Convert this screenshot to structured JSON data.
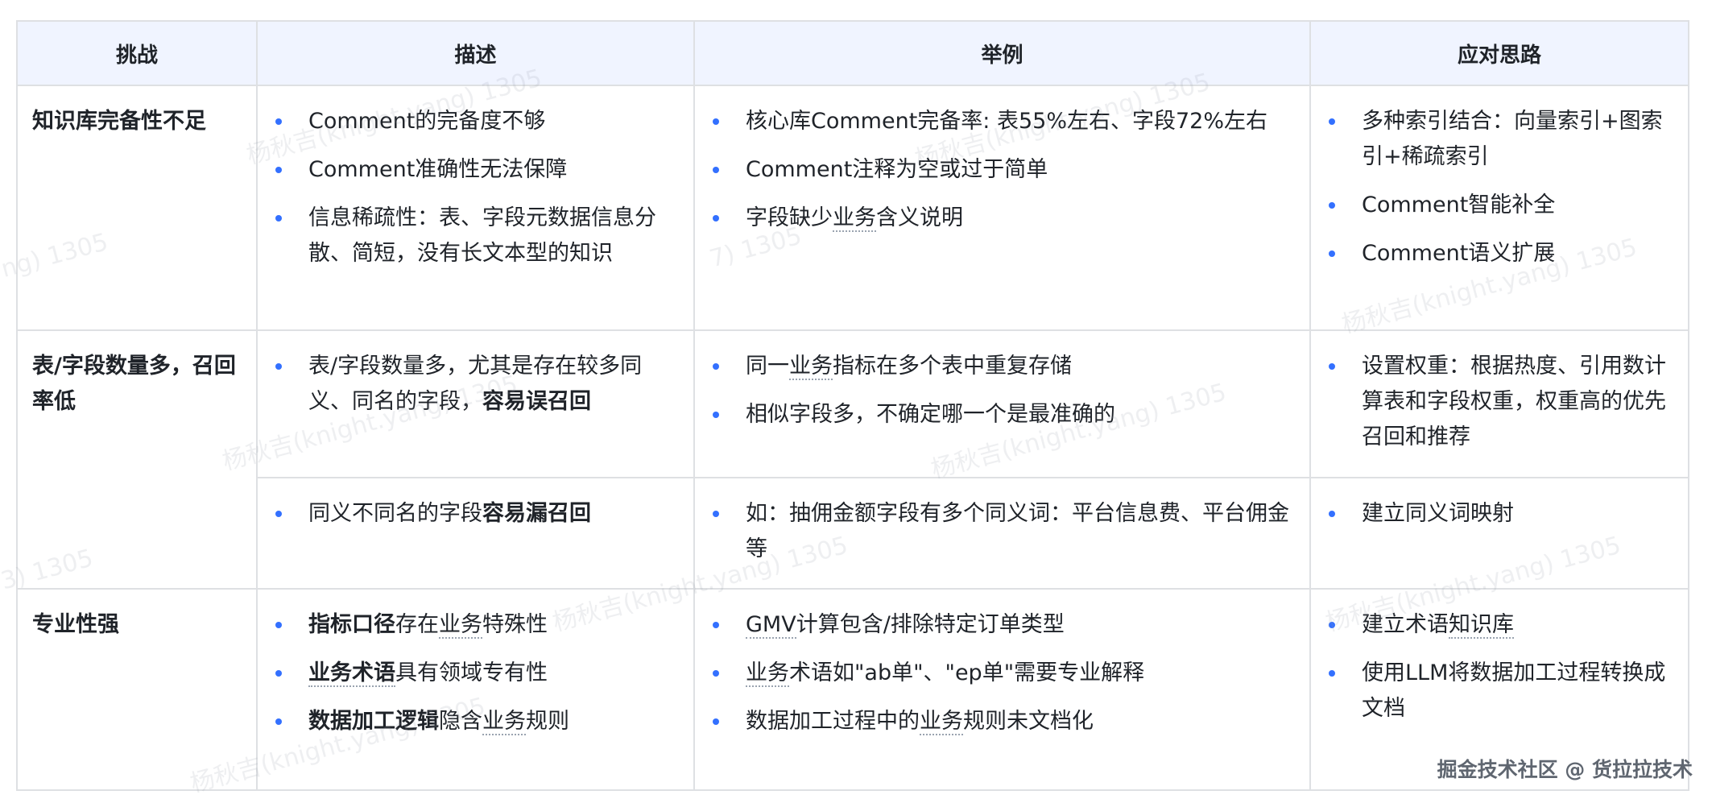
{
  "headers": [
    "挑战",
    "描述",
    "举例",
    "应对思路"
  ],
  "rows": [
    {
      "challenge": "知识库完备性不足",
      "description": [
        [
          {
            "t": "Comment的完备度不够"
          }
        ],
        [
          {
            "t": "Comment准确性无法保障"
          }
        ],
        [
          {
            "t": "信息稀疏性：表、字段元数据信息分散、简短，没有长文本型的知识"
          }
        ]
      ],
      "example": [
        [
          {
            "t": "核心库Comment完备率: 表55%左右、字段72%左右"
          }
        ],
        [
          {
            "t": "Comment注释为空或过于简单"
          }
        ],
        [
          {
            "t": "字段缺少"
          },
          {
            "t": "业务",
            "u": true
          },
          {
            "t": "含义说明"
          }
        ]
      ],
      "approach": [
        [
          {
            "t": "多种索引结合：向量索引+图索引+稀疏索引"
          }
        ],
        [
          {
            "t": "Comment智能补全"
          }
        ],
        [
          {
            "t": "Comment语义扩展"
          }
        ]
      ]
    },
    {
      "challenge": "表/字段数量多，召回率低",
      "description": [
        [
          {
            "t": "表/字段数量多，尤其是存在较多同义、同名的字段，"
          },
          {
            "t": "容易误召回",
            "b": true
          }
        ]
      ],
      "example": [
        [
          {
            "t": "同一"
          },
          {
            "t": "业务",
            "u": true
          },
          {
            "t": "指标在多个表中重复存储"
          }
        ],
        [
          {
            "t": "相似字段多，不确定哪一个是最准确的"
          }
        ]
      ],
      "approach": [
        [
          {
            "t": "设置权重：根据热度、引用数计算表和字段权重，权重高的优先召回和推荐"
          }
        ]
      ]
    },
    {
      "challenge": "",
      "description": [
        [
          {
            "t": "同义不同名的字段"
          },
          {
            "t": "容易漏召回",
            "b": true
          }
        ]
      ],
      "example": [
        [
          {
            "t": "如：抽佣金额字段有多个同义词：平台信息费、平台佣金等"
          }
        ]
      ],
      "approach": [
        [
          {
            "t": "建立同义词映射"
          }
        ]
      ]
    },
    {
      "challenge": "专业性强",
      "description": [
        [
          {
            "t": "指标口径",
            "b": true
          },
          {
            "t": "存在"
          },
          {
            "t": "业务",
            "u": true
          },
          {
            "t": "特殊性"
          }
        ],
        [
          {
            "t": "业务术语",
            "b": true,
            "u": true
          },
          {
            "t": "具有领域专有性"
          }
        ],
        [
          {
            "t": "数据加工逻辑",
            "b": true
          },
          {
            "t": "隐含"
          },
          {
            "t": "业务",
            "u": true
          },
          {
            "t": "规则"
          }
        ]
      ],
      "example": [
        [
          {
            "t": "GMV",
            "u": true
          },
          {
            "t": "计算包含/排除特定订单类型"
          }
        ],
        [
          {
            "t": "业务",
            "u": true
          },
          {
            "t": "术语如\"ab单\"、\"ep单\"需要专业解释"
          }
        ],
        [
          {
            "t": "数据加工过程中的"
          },
          {
            "t": "业务",
            "u": true
          },
          {
            "t": "规则未文档化"
          }
        ]
      ],
      "approach": [
        [
          {
            "t": "建立术语"
          },
          {
            "t": "知识库",
            "u": true
          }
        ],
        [
          {
            "t": "使用LLM将数据加工过程转换成文档"
          }
        ]
      ]
    }
  ],
  "watermark": {
    "text": "杨秋吉(knight.yang) 1305",
    "partial_texts": [
      "ng) 1305",
      "3) 1305",
      "7) 1305"
    ]
  },
  "site_mark": "掘金技术社区 @ 货拉拉技术",
  "colors": {
    "header_bg": "#f0f4ff",
    "border": "#dee0e3",
    "bullet": "#3370ff",
    "text": "#1f2329"
  }
}
